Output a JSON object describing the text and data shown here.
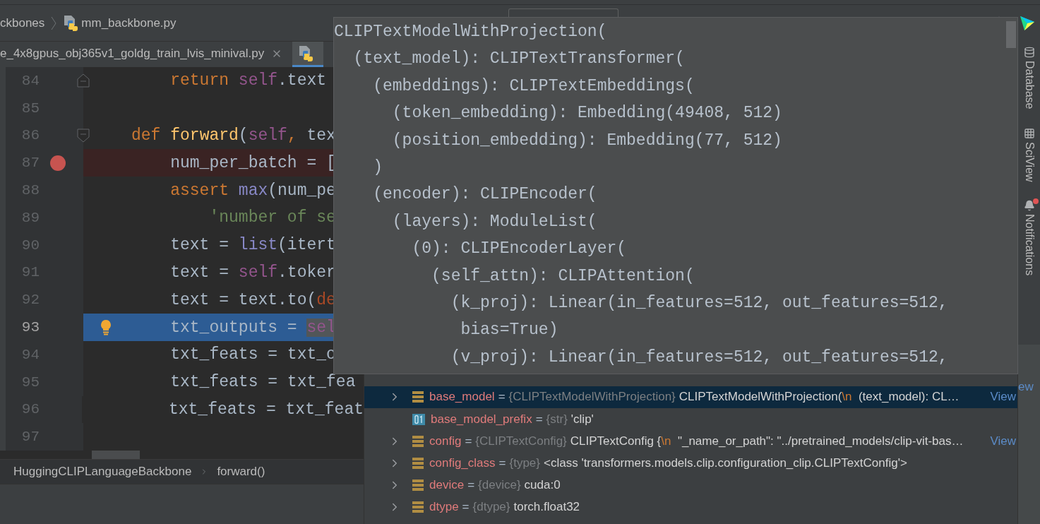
{
  "breadcrumb": [
    "ckbones",
    "mm_backbone.py"
  ],
  "tabs": [
    {
      "label": "e_4x8gpus_obj365v1_goldg_train_lvis_minival.py",
      "selected": false,
      "closable": true
    },
    {
      "selected": true,
      "closable": false
    }
  ],
  "editor": {
    "lines": [
      {
        "number": "84",
        "kind": "fold_end",
        "breakpoint": false,
        "current": false,
        "tokens": [
          {
            "kind": "kw",
            "text": "    return "
          },
          {
            "kind": "self",
            "text": "self"
          },
          {
            "kind": "plain",
            "text": ".text"
          }
        ]
      },
      {
        "number": "85",
        "kind": "plain",
        "breakpoint": false,
        "current": false
      },
      {
        "number": "86",
        "kind": "fold_start",
        "breakpoint": false,
        "current": false,
        "tokens": [
          {
            "kind": "kw",
            "text": "def "
          },
          {
            "kind": "func",
            "text": "forward"
          },
          {
            "kind": "plain",
            "text": "("
          },
          {
            "kind": "self",
            "text": "self"
          },
          {
            "kind": "kw",
            "text": ","
          },
          {
            "kind": "plain",
            "text": " tex"
          }
        ]
      },
      {
        "number": "87",
        "kind": "plain",
        "breakpoint": true,
        "current": false,
        "tokens": [
          {
            "kind": "plain",
            "text": "    num_per_batch = ["
          }
        ]
      },
      {
        "number": "88",
        "kind": "plain",
        "breakpoint": false,
        "current": false,
        "tokens": [
          {
            "kind": "kw",
            "text": "    assert "
          },
          {
            "kind": "builtin",
            "text": "max"
          },
          {
            "kind": "plain",
            "text": "(num_pe"
          }
        ]
      },
      {
        "number": "89",
        "kind": "plain",
        "breakpoint": false,
        "current": false,
        "tokens": [
          {
            "kind": "string",
            "text": "        'number of se"
          }
        ]
      },
      {
        "number": "90",
        "kind": "plain",
        "breakpoint": false,
        "current": false,
        "tokens": [
          {
            "kind": "plain",
            "text": "    text = "
          },
          {
            "kind": "builtin",
            "text": "list"
          },
          {
            "kind": "plain",
            "text": "(itert"
          }
        ]
      },
      {
        "number": "91",
        "kind": "plain",
        "breakpoint": false,
        "current": false,
        "tokens": [
          {
            "kind": "plain",
            "text": "    text = "
          },
          {
            "kind": "self",
            "text": "self"
          },
          {
            "kind": "plain",
            "text": ".toker"
          }
        ]
      },
      {
        "number": "92",
        "kind": "plain",
        "breakpoint": false,
        "current": false,
        "tokens": [
          {
            "kind": "plain",
            "text": "    text = text.to("
          },
          {
            "kind": "param",
            "text": "de"
          }
        ]
      },
      {
        "number": "93",
        "kind": "plain",
        "breakpoint": false,
        "current": true,
        "tokens": [
          {
            "kind": "plain",
            "text": "    txt_outputs = "
          },
          {
            "kind": "self",
            "text": "sel",
            "highlight": true
          }
        ]
      },
      {
        "number": "94",
        "kind": "plain",
        "breakpoint": false,
        "current": false,
        "tokens": [
          {
            "kind": "plain",
            "text": "    txt_feats = txt_o"
          }
        ]
      },
      {
        "number": "95",
        "kind": "plain",
        "breakpoint": false,
        "current": false,
        "tokens": [
          {
            "kind": "plain",
            "text": "    txt_feats = txt_fea"
          }
        ]
      },
      {
        "number": "96",
        "kind": "plain",
        "breakpoint": false,
        "current": false,
        "tokens": [
          {
            "kind": "plain",
            "text": "    txt_feats = txt_feat"
          }
        ]
      },
      {
        "number": "97",
        "kind": "plain",
        "breakpoint": false,
        "current": false
      }
    ]
  },
  "footer_breadcrumb": [
    "HuggingCLIPLanguageBackbone",
    "forward()"
  ],
  "variables": {
    "partial_link": "ew",
    "rows": [
      {
        "kind": "object",
        "expandable": true,
        "selected": true,
        "name": "base_model",
        "operator": "=",
        "type": "{CLIPTextModelWithProjection}",
        "value": [
          {
            "text": "CLIPTextModelWithProjection("
          },
          {
            "text": "\\n",
            "kind": "escape"
          },
          {
            "text": "  (text_model): CL…"
          }
        ],
        "link": "View"
      },
      {
        "kind": "string",
        "expandable": false,
        "selected": false,
        "name": "base_model_prefix",
        "operator": "=",
        "type": "{str}",
        "value": [
          {
            "text": "'clip'"
          }
        ]
      },
      {
        "kind": "object",
        "expandable": true,
        "selected": false,
        "name": "config",
        "operator": "=",
        "type": "{CLIPTextConfig}",
        "value": [
          {
            "text": "CLIPTextConfig {"
          },
          {
            "text": "\\n",
            "kind": "escape"
          },
          {
            "text": "  \"_name_or_path\": \"../pretrained_models/clip-vit-bas…"
          }
        ],
        "link": "View"
      },
      {
        "kind": "object",
        "expandable": true,
        "selected": false,
        "name": "config_class",
        "operator": "=",
        "type": "{type}",
        "value": [
          {
            "text": "<class 'transformers.models.clip.configuration_clip.CLIPTextConfig'>"
          }
        ]
      },
      {
        "kind": "object",
        "expandable": true,
        "selected": false,
        "name": "device",
        "operator": "=",
        "type": "{device}",
        "value": [
          {
            "text": "cuda:0"
          }
        ]
      },
      {
        "kind": "object",
        "expandable": true,
        "selected": false,
        "name": "dtype",
        "operator": "=",
        "type": "{dtype}",
        "value": [
          {
            "text": "torch.float32"
          }
        ]
      }
    ]
  },
  "tool_strip": [
    {
      "kind": "database",
      "label": "Database",
      "badge": false
    },
    {
      "kind": "grid",
      "label": "SciView",
      "badge": false
    },
    {
      "kind": "bell",
      "label": "Notifications",
      "badge": true
    }
  ],
  "popup": {
    "lines": [
      "CLIPTextModelWithProjection(",
      "  (text_model): CLIPTextTransformer(",
      "    (embeddings): CLIPTextEmbeddings(",
      "      (token_embedding): Embedding(49408, 512)",
      "      (position_embedding): Embedding(77, 512)",
      "    )",
      "    (encoder): CLIPEncoder(",
      "      (layers): ModuleList(",
      "        (0): CLIPEncoderLayer(",
      "          (self_attn): CLIPAttention(",
      "            (k_proj): Linear(in_features=512, out_features=512,",
      "             bias=True)",
      "            (v_proj): Linear(in_features=512, out_features=512,"
    ]
  }
}
